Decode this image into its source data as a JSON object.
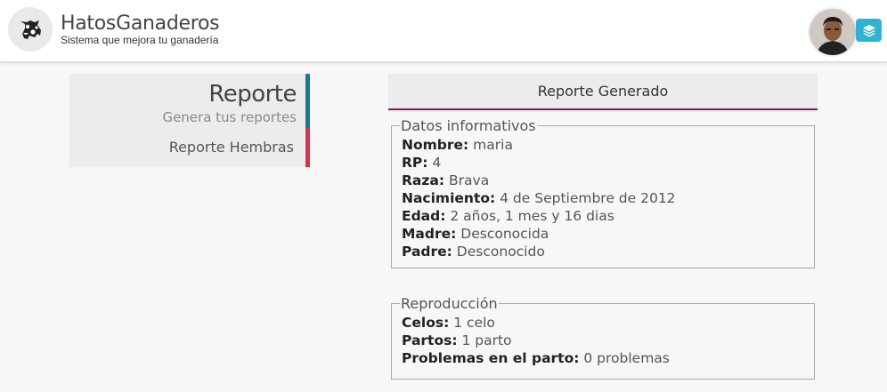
{
  "header": {
    "brand_title": "HatosGanaderos",
    "brand_subtitle": "Sistema que mejora tu ganadería",
    "logo_icon": "cow-icon",
    "avatar_icon": "user-avatar",
    "menu_icon": "layers-icon",
    "accent_color": "#2fb3d1"
  },
  "sidebar": {
    "title": "Reporte",
    "subtitle": "Genera tus reportes",
    "items": [
      {
        "label": "Reporte Hembras"
      }
    ],
    "accent_top": "#1a7a8c",
    "accent_item": "#d6334e"
  },
  "panel": {
    "title": "Reporte Generado",
    "underline_color": "#8a1560",
    "sections": [
      {
        "legend": "Datos informativos",
        "rows": [
          {
            "label": "Nombre:",
            "value": "maria"
          },
          {
            "label": "RP:",
            "value": "4"
          },
          {
            "label": "Raza:",
            "value": "Brava"
          },
          {
            "label": "Nacimiento:",
            "value": "4 de Septiembre de 2012"
          },
          {
            "label": "Edad:",
            "value": "2 años, 1 mes y 16 dias"
          },
          {
            "label": "Madre:",
            "value": "Desconocida"
          },
          {
            "label": "Padre:",
            "value": "Desconocido"
          }
        ]
      },
      {
        "legend": "Reproducción",
        "rows": [
          {
            "label": "Celos:",
            "value": "1 celo"
          },
          {
            "label": "Partos:",
            "value": "1 parto"
          },
          {
            "label": "Problemas en el parto:",
            "value": "0 problemas"
          }
        ]
      }
    ]
  }
}
